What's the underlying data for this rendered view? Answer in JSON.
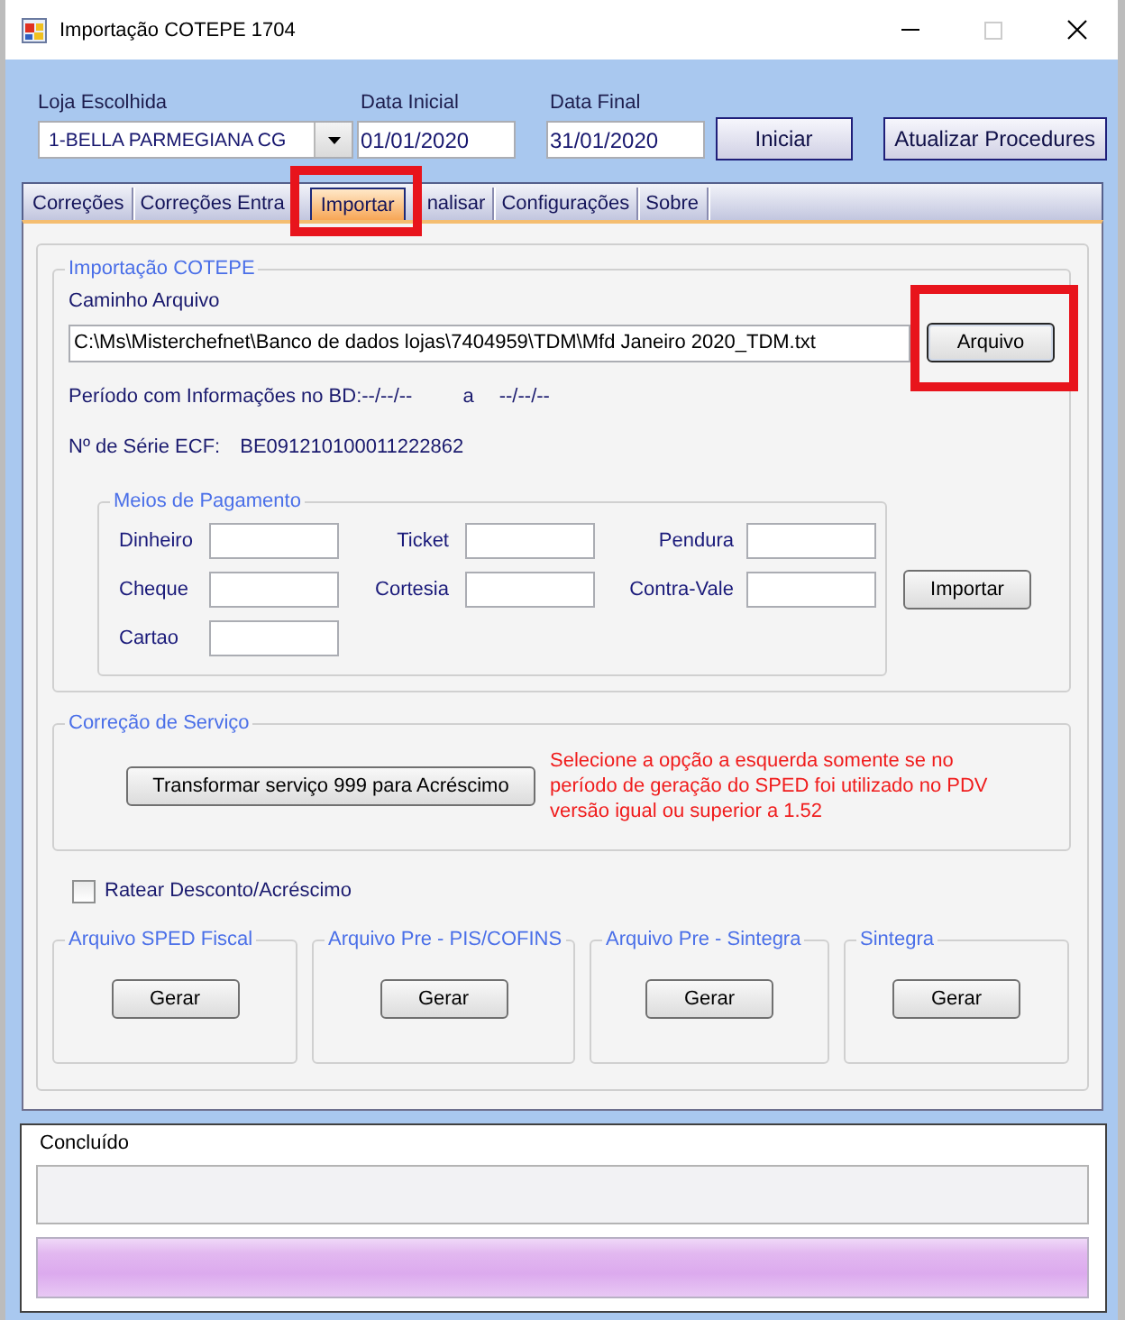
{
  "window": {
    "title": "Importação COTEPE 1704",
    "caption_buttons": [
      {
        "kind": "minimize",
        "disabled": false
      },
      {
        "kind": "maximize",
        "disabled": true
      },
      {
        "kind": "close",
        "disabled": false
      }
    ]
  },
  "header": {
    "store": {
      "label": "Loja Escolhida",
      "value": "1-BELLA PARMEGIANA CG"
    },
    "start_date": {
      "label": "Data Inicial",
      "value": "01/01/2020"
    },
    "end_date": {
      "label": "Data Final",
      "value": "31/01/2020"
    },
    "buttons": [
      "Iniciar",
      "Atualizar Procedures"
    ]
  },
  "tabs": [
    {
      "label": "Correções",
      "selected": false,
      "highlighted": false
    },
    {
      "label": "Correções Entra",
      "selected": false,
      "highlighted": false
    },
    {
      "label": "Importar",
      "selected": true,
      "highlighted": true
    },
    {
      "label": "nalisar",
      "selected": false,
      "highlighted": false
    },
    {
      "label": "Configurações",
      "selected": false,
      "highlighted": false
    },
    {
      "label": "Sobre",
      "selected": false,
      "highlighted": false
    }
  ],
  "import_group": {
    "title": "Importação COTEPE",
    "path_label": "Caminho Arquivo",
    "path_value": "C:\\Ms\\Misterchefnet\\Banco de dados lojas\\7404959\\TDM\\Mfd Janeiro 2020_TDM.txt",
    "browse_button": {
      "label": "Arquivo",
      "focused": true,
      "highlighted": true
    },
    "period_label": "Período com Informações no BD:--/--/--",
    "period_separator": "a",
    "period_end": "--/--/--",
    "serial_label": "Nº de Série ECF:",
    "serial_value": "BE091210100011222862",
    "payment_group": {
      "title": "Meios de Pagamento",
      "fields": [
        {
          "label": "Dinheiro"
        },
        {
          "label": "Ticket"
        },
        {
          "label": "Pendura"
        },
        {
          "label": "Cheque"
        },
        {
          "label": "Cortesia"
        },
        {
          "label": "Contra-Vale"
        },
        {
          "label": "Cartao"
        }
      ]
    },
    "import_button": "Importar"
  },
  "service_group": {
    "title": "Correção de Serviço",
    "button": "Transformar serviço 999 para Acréscimo",
    "note_lines": [
      "Selecione a opção a esquerda somente se no",
      "período de geração do SPED foi utilizado no PDV",
      "versão igual ou superior a 1.52"
    ]
  },
  "prorate_checkbox": {
    "label": "Ratear Desconto/Acréscimo",
    "checked": false
  },
  "export_groups": [
    {
      "title": "Arquivo SPED Fiscal",
      "button": "Gerar"
    },
    {
      "title": "Arquivo Pre - PIS/COFINS",
      "button": "Gerar"
    },
    {
      "title": "Arquivo Pre - Sintegra",
      "button": "Gerar"
    },
    {
      "title": "Sintegra",
      "button": "Gerar"
    }
  ],
  "status": {
    "label": "Concluído",
    "progress": {
      "level": 1
    }
  }
}
